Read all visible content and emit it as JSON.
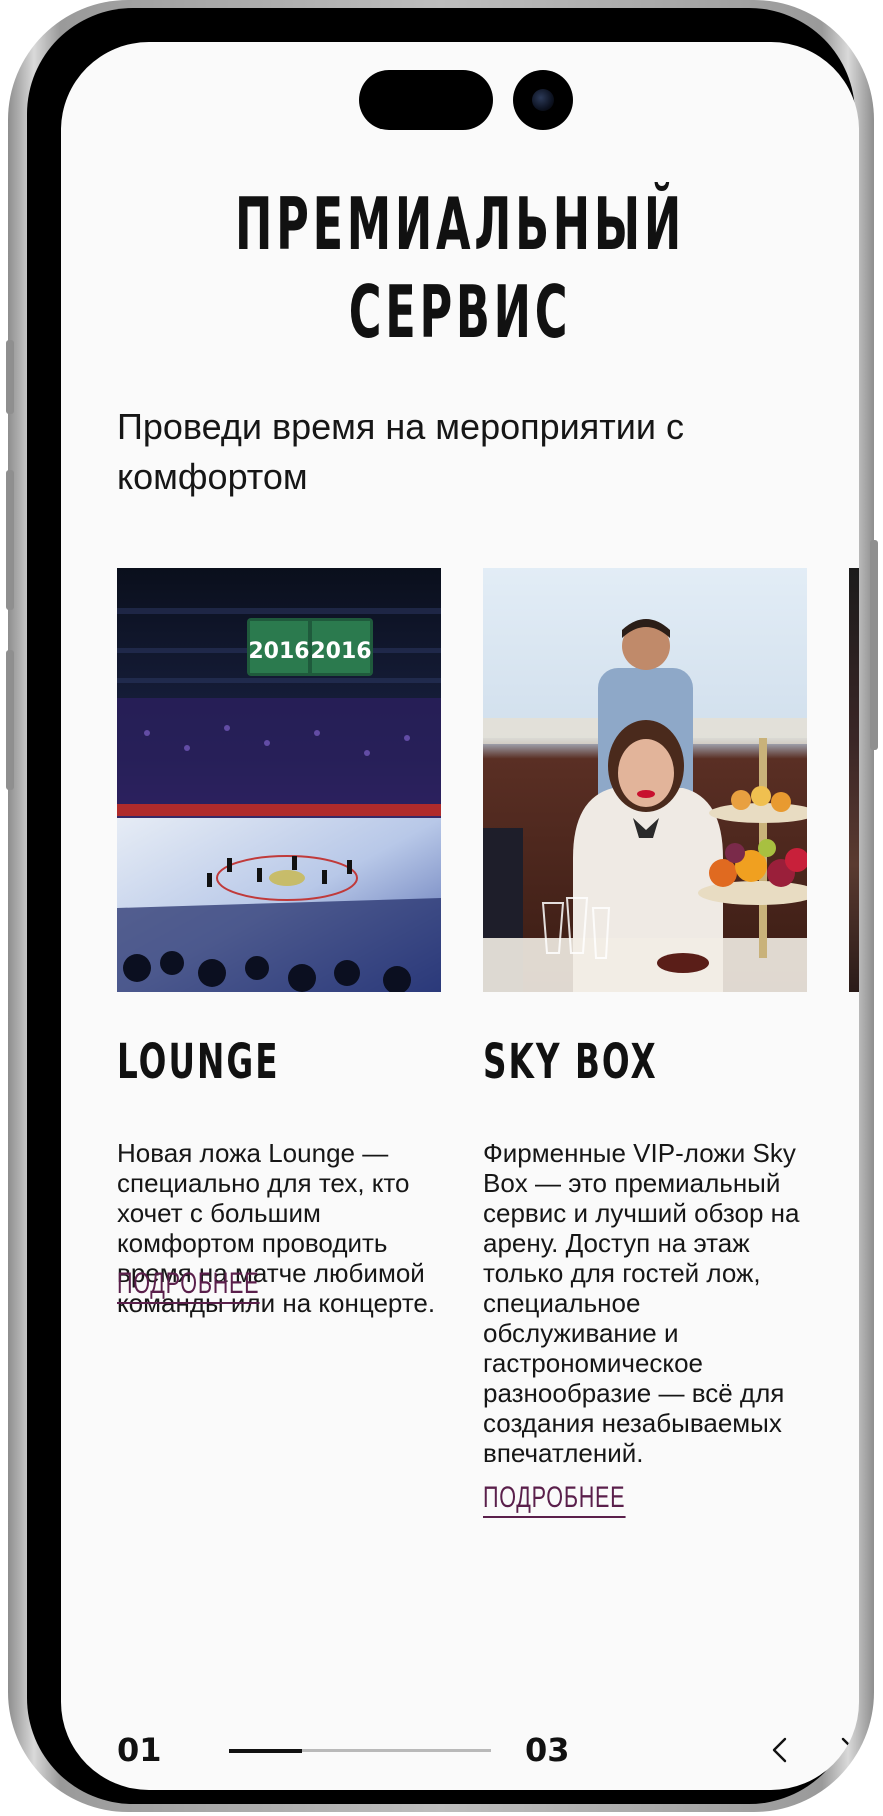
{
  "page": {
    "title": "ПРЕМИАЛЬНЫЙ\nСЕРВИС",
    "subtitle": "Проведи время на мероприятии с комфортом"
  },
  "cards": [
    {
      "name": "LOUNGE",
      "description": "Новая ложа Lounge — специально для тех, кто хочет с большим комфортом проводить время на матче любимой команды или на концерте.",
      "more_label": "ПОДРОБНЕЕ",
      "photo_text": "2016"
    },
    {
      "name": "SKY BOX",
      "description": "Фирменные VIP-ложи Sky Box — это премиальный сервис и лучший обзор на арену. Доступ на этаж только для гостей лож, специальное обслуживание и гастрономическое разнообразие — всё для создания незабываемых впечатлений.",
      "more_label": "ПОДРОБНЕЕ"
    }
  ],
  "pager": {
    "current": "01",
    "total": "03",
    "progress": 0.28
  },
  "icons": {
    "prev": "chevron-left-icon",
    "next": "chevron-right-icon"
  },
  "colors": {
    "accent": "#5a1f4b",
    "text": "#111111",
    "background": "#fafafa"
  }
}
